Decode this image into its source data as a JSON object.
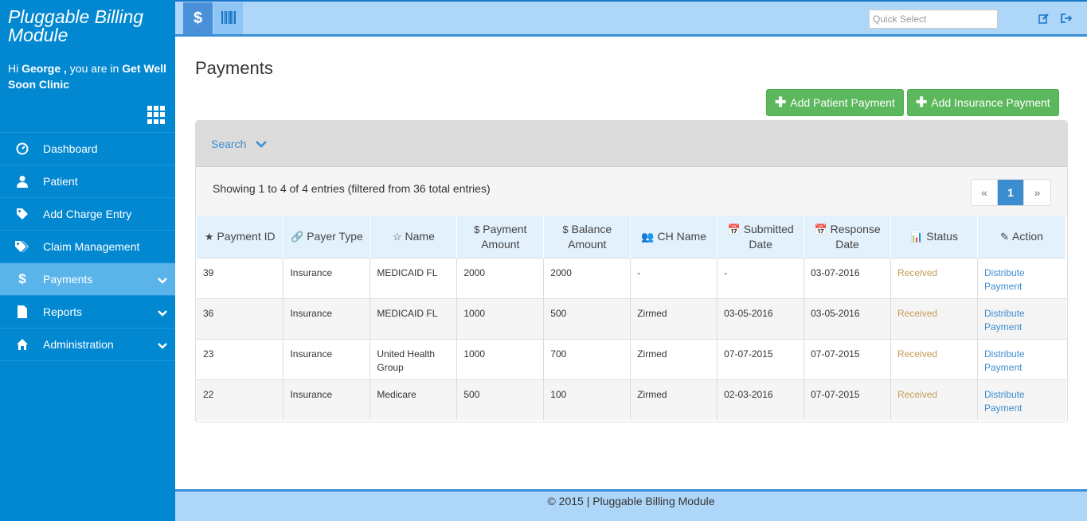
{
  "sidebar": {
    "brand": "Pluggable Billing Module",
    "greeting_prefix": "Hi ",
    "user_name": "George ,",
    "greeting_mid": " you are in ",
    "clinic": "Get Well Soon Clinic",
    "items": [
      {
        "label": "Dashboard",
        "icon": "dashboard-icon"
      },
      {
        "label": "Patient",
        "icon": "user-icon"
      },
      {
        "label": "Add Charge Entry",
        "icon": "tag-icon"
      },
      {
        "label": "Claim Management",
        "icon": "tags-icon"
      },
      {
        "label": "Payments",
        "icon": "dollar-icon"
      },
      {
        "label": "Reports",
        "icon": "file-icon"
      },
      {
        "label": "Administration",
        "icon": "home-icon"
      }
    ]
  },
  "topbar": {
    "tab_dollar": "$",
    "quick_select_placeholder": "Quick Select"
  },
  "main": {
    "title": "Payments",
    "add_patient_payment": "Add Patient Payment",
    "add_insurance_payment": "Add Insurance Payment",
    "search_label": "Search",
    "showing": "Showing 1 to 4 of 4 entries (filtered from 36 total entries)",
    "pager": {
      "prev": "«",
      "current": "1",
      "next": "»"
    },
    "columns": [
      {
        "icon": "★",
        "line1": "Payment ID",
        "line2": ""
      },
      {
        "icon": "🔗",
        "line1": "Payer Type",
        "line2": ""
      },
      {
        "icon": "☆",
        "line1": "Name",
        "line2": ""
      },
      {
        "icon": "$",
        "line1": "Payment",
        "line2": "Amount"
      },
      {
        "icon": "$",
        "line1": "Balance",
        "line2": "Amount"
      },
      {
        "icon": "👥",
        "line1": "CH Name",
        "line2": ""
      },
      {
        "icon": "📅",
        "line1": "Submitted",
        "line2": "Date"
      },
      {
        "icon": "📅",
        "line1": "Response",
        "line2": "Date"
      },
      {
        "icon": "📊",
        "line1": "Status",
        "line2": ""
      },
      {
        "icon": "✎",
        "line1": "Action",
        "line2": ""
      }
    ],
    "rows": [
      {
        "id": "39",
        "payer": "Insurance",
        "name": "MEDICAID FL",
        "payment": "2000",
        "balance": "2000",
        "ch": "-",
        "submitted": "-",
        "response": "03-07-2016",
        "status": "Received",
        "action1": "Distribute",
        "action2": "Payment"
      },
      {
        "id": "36",
        "payer": "Insurance",
        "name": "MEDICAID FL",
        "payment": "1000",
        "balance": "500",
        "ch": "Zirmed",
        "submitted": "03-05-2016",
        "response": "03-05-2016",
        "status": "Received",
        "action1": "Distribute",
        "action2": "Payment"
      },
      {
        "id": "23",
        "payer": "Insurance",
        "name": "United Health Group",
        "payment": "1000",
        "balance": "700",
        "ch": "Zirmed",
        "submitted": "07-07-2015",
        "response": "07-07-2015",
        "status": "Received",
        "action1": "Distribute",
        "action2": "Payment"
      },
      {
        "id": "22",
        "payer": "Insurance",
        "name": "Medicare",
        "payment": "500",
        "balance": "100",
        "ch": "Zirmed",
        "submitted": "02-03-2016",
        "response": "07-07-2015",
        "status": "Received",
        "action1": "Distribute",
        "action2": "Payment"
      }
    ]
  },
  "footer": {
    "text": "© 2015 | Pluggable Billing Module"
  },
  "colors": {
    "sidebar": "#0288d1",
    "active": "#5ab4ea",
    "green": "#5cb85c",
    "link": "#3c8dd0",
    "status": "#c49a53"
  }
}
